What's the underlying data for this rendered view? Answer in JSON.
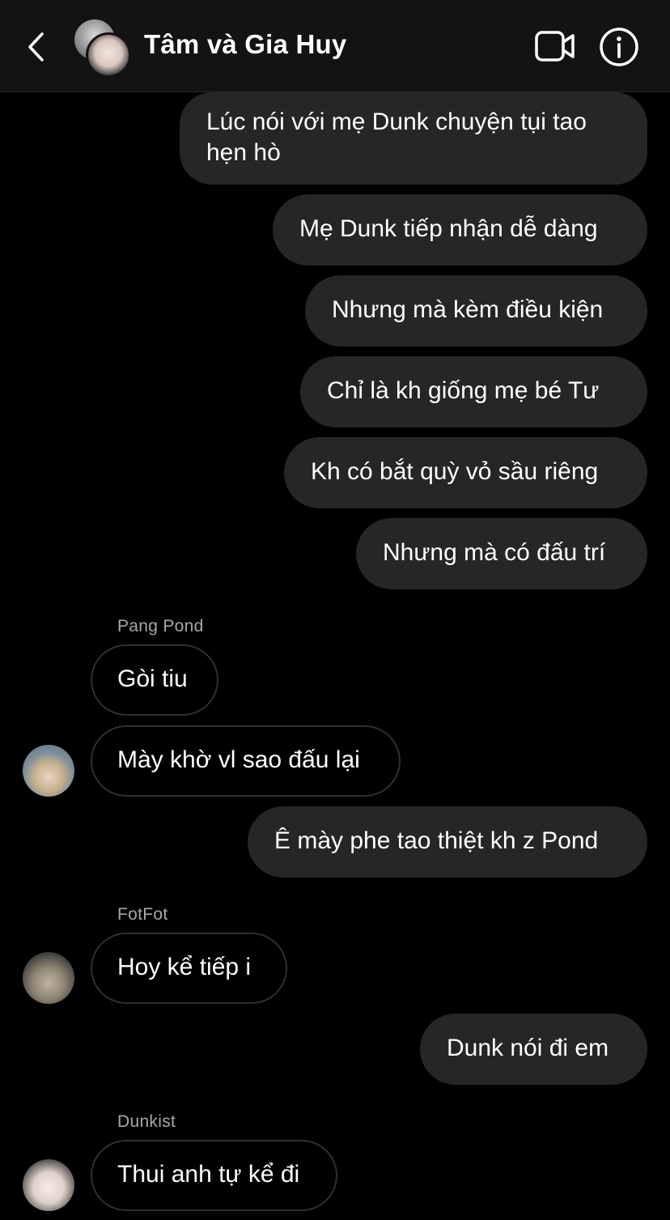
{
  "header": {
    "title": "Tâm và Gia Huy",
    "back_icon": "chevron-left-icon",
    "video_icon": "video-camera-icon",
    "info_icon": "info-icon"
  },
  "colors": {
    "background": "#000000",
    "header_bg": "#131313",
    "outgoing_bubble": "#262626",
    "incoming_border": "#303030",
    "sender_name": "#a8a8a8"
  },
  "messages": [
    {
      "text": "Lúc nói với mẹ Dunk chuyện tụi tao hẹn hò",
      "direction": "outgoing"
    },
    {
      "text": "Mẹ Dunk tiếp nhận dễ dàng",
      "direction": "outgoing"
    },
    {
      "text": "Nhưng mà kèm điều kiện",
      "direction": "outgoing"
    },
    {
      "text": "Chỉ là kh giống mẹ bé Tư",
      "direction": "outgoing"
    },
    {
      "text": "Kh có bắt quỳ vỏ sầu riêng",
      "direction": "outgoing"
    },
    {
      "text": "Nhưng mà có đấu trí",
      "direction": "outgoing"
    },
    {
      "sender": "Pang Pond",
      "text": "Gòi tiu",
      "direction": "incoming"
    },
    {
      "text": "Mày khờ vl sao đấu lại",
      "direction": "incoming"
    },
    {
      "text": "Ê mày phe tao thiệt kh z Pond",
      "direction": "outgoing"
    },
    {
      "sender": "FotFot",
      "text": "Hoy kể tiếp i",
      "direction": "incoming"
    },
    {
      "text": "Dunk nói đi em",
      "direction": "outgoing"
    },
    {
      "sender": "Dunkist",
      "text": "Thui anh tự kể đi",
      "direction": "incoming"
    }
  ]
}
